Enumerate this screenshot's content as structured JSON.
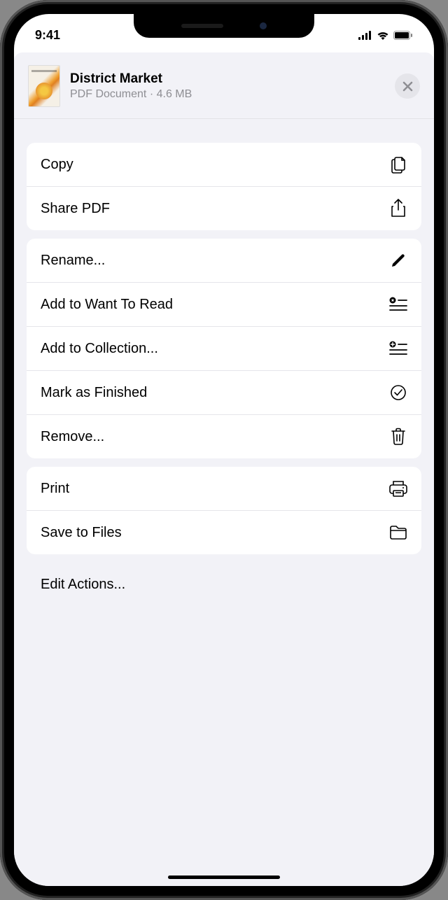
{
  "status_bar": {
    "time": "9:41"
  },
  "header": {
    "title": "District Market",
    "type": "PDF Document",
    "size": "4.6 MB"
  },
  "groups": [
    {
      "items": [
        {
          "label": "Copy",
          "icon": "copy"
        },
        {
          "label": "Share PDF",
          "icon": "share"
        }
      ]
    },
    {
      "items": [
        {
          "label": "Rename...",
          "icon": "pencil"
        },
        {
          "label": "Add to Want To Read",
          "icon": "star-list"
        },
        {
          "label": "Add to Collection...",
          "icon": "plus-list"
        },
        {
          "label": "Mark as Finished",
          "icon": "checkmark-circle"
        },
        {
          "label": "Remove...",
          "icon": "trash"
        }
      ]
    },
    {
      "items": [
        {
          "label": "Print",
          "icon": "printer"
        },
        {
          "label": "Save to Files",
          "icon": "folder"
        }
      ]
    }
  ],
  "footer": {
    "edit_actions": "Edit Actions..."
  }
}
